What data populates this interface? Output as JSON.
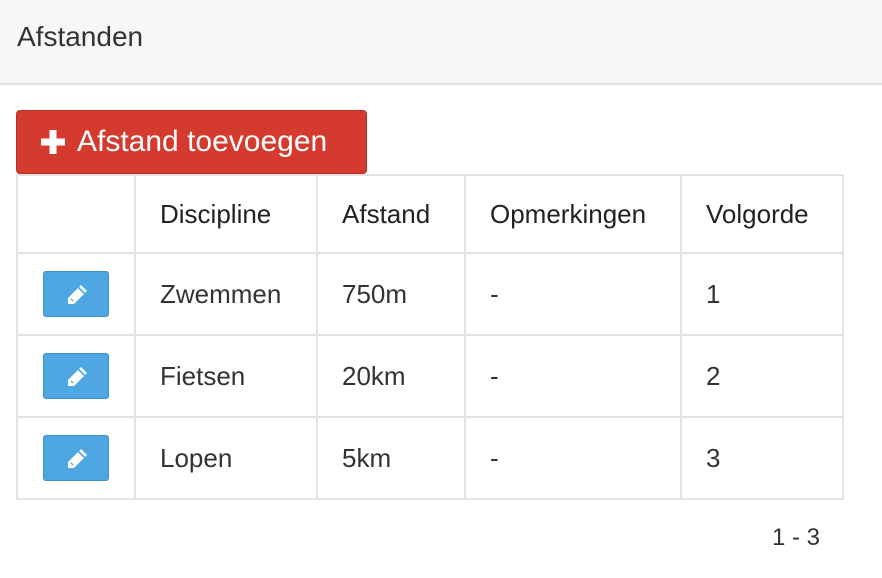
{
  "panel": {
    "title": "Afstanden"
  },
  "toolbar": {
    "add_label": "Afstand toevoegen",
    "add_color": "#d43b2e"
  },
  "table": {
    "columns": [
      "",
      "Discipline",
      "Afstand",
      "Opmerkingen",
      "Volgorde"
    ],
    "rows": [
      {
        "discipline": "Zwemmen",
        "afstand": "750m",
        "opmerkingen": "-",
        "volgorde": "1"
      },
      {
        "discipline": "Fietsen",
        "afstand": "20km",
        "opmerkingen": "-",
        "volgorde": "2"
      },
      {
        "discipline": "Lopen",
        "afstand": "5km",
        "opmerkingen": "-",
        "volgorde": "3"
      }
    ],
    "edit_icon": "pencil-icon",
    "edit_color": "#4ea7e3"
  },
  "pagination": {
    "range": "1 - 3"
  }
}
